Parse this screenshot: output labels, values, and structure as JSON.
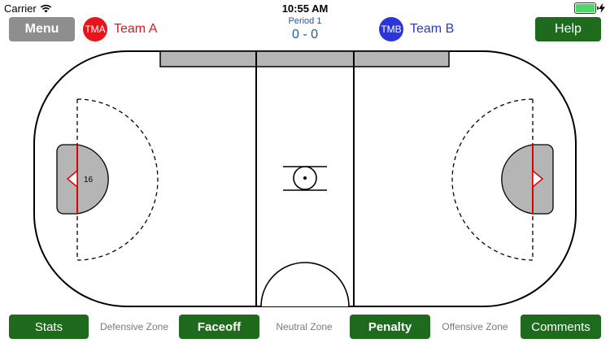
{
  "status_bar": {
    "carrier": "Carrier",
    "time": "10:55 AM",
    "icons": [
      "wifi-icon",
      "battery-icon",
      "charging-bolt-icon"
    ]
  },
  "header": {
    "menu_label": "Menu",
    "help_label": "Help",
    "period_label": "Period 1",
    "score": "0 - 0",
    "team_a": {
      "badge": "TMA",
      "name": "Team A",
      "color": "#e8141a"
    },
    "team_b": {
      "badge": "TMB",
      "name": "Team B",
      "color": "#2a36d8"
    }
  },
  "rink": {
    "player_marker": "16"
  },
  "footer": {
    "stats_label": "Stats",
    "faceoff_label": "Faceoff",
    "penalty_label": "Penalty",
    "comments_label": "Comments",
    "zones": [
      "Defensive Zone",
      "Neutral Zone",
      "Offensive Zone"
    ]
  },
  "colors": {
    "button_green": "#1e6b1e",
    "menu_gray": "#8e8e8e",
    "score_blue": "#2456a6",
    "crease_gray": "#b5b5b5",
    "goal_line_red": "#e00000"
  }
}
